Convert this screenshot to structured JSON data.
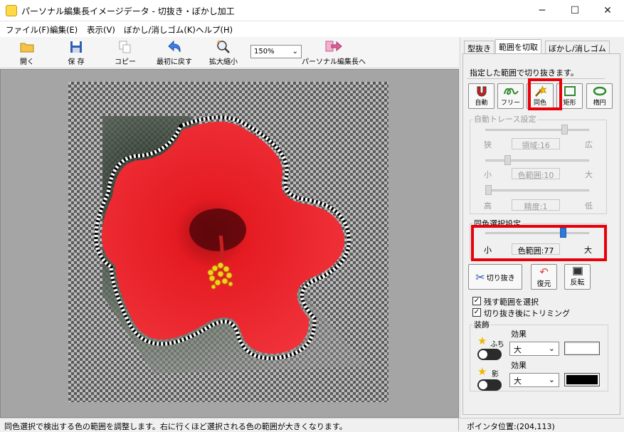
{
  "window": {
    "title": "パーソナル編集長イメージデータ - 切抜き・ぼかし加工",
    "minimize": "─",
    "maximize": "☐",
    "close": "✕"
  },
  "menu": [
    "ファイル(F)",
    "編集(E)",
    "表示(V)",
    "ぼかし/消しゴム(K)",
    "ヘルプ(H)"
  ],
  "toolbar": {
    "open": "開く",
    "save": "保 存",
    "copy": "コピー",
    "revert": "最初に戻す",
    "zoom_label": "拡大縮小",
    "zoom_value": "150%",
    "send": "パーソナル編集長へ"
  },
  "tabs": [
    "型抜き",
    "範囲を切取",
    "ぼかし/消しゴム"
  ],
  "panel": {
    "hint": "指定した範囲で切り抜きます。",
    "modes": [
      "自動",
      "フリー",
      "同色",
      "矩形",
      "楕円"
    ],
    "auto_trace": {
      "title": "自動トレース設定",
      "rows": [
        {
          "left": "狭",
          "right": "広",
          "value": "領域:16",
          "level": 0.78
        },
        {
          "left": "小",
          "right": "大",
          "value": "色範囲:10",
          "level": 0.2
        },
        {
          "left": "高",
          "right": "低",
          "value": "精度:1",
          "level": 0.0
        }
      ]
    },
    "same_color": {
      "title": "同色選択設定",
      "left": "小",
      "right": "大",
      "value": "色範囲:77",
      "level": 0.77
    },
    "actions": {
      "cut": "切り抜き",
      "restore": "復元",
      "invert": "反転"
    },
    "checks": [
      {
        "label": "残す範囲を選択",
        "checked": true
      },
      {
        "label": "切り抜き後にトリミング",
        "checked": true
      }
    ],
    "decoration": {
      "title": "装飾",
      "border": {
        "label": "ふち",
        "effect_label": "効果",
        "size": "大",
        "color": "#ffffff"
      },
      "shadow": {
        "label": "影",
        "effect_label": "効果",
        "size": "大",
        "color": "#000000"
      }
    }
  },
  "status": {
    "message": "同色選択で検出する色の範囲を調整します。右に行くほど選択される色の範囲が大きくなります。",
    "pointer": "ポインタ位置:(204,113)"
  },
  "colors": {
    "highlight": "#e8000b",
    "flower": "#e8121b",
    "slider_active": "#2f7ad8"
  }
}
